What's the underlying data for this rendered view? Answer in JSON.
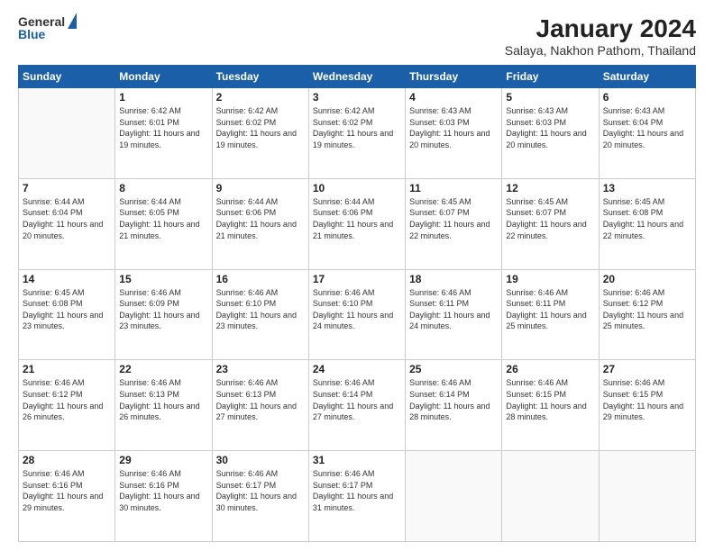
{
  "header": {
    "logo_general": "General",
    "logo_blue": "Blue",
    "title": "January 2024",
    "subtitle": "Salaya, Nakhon Pathom, Thailand"
  },
  "days_of_week": [
    "Sunday",
    "Monday",
    "Tuesday",
    "Wednesday",
    "Thursday",
    "Friday",
    "Saturday"
  ],
  "weeks": [
    [
      {
        "day": "",
        "sunrise": "",
        "sunset": "",
        "daylight": ""
      },
      {
        "day": "1",
        "sunrise": "Sunrise: 6:42 AM",
        "sunset": "Sunset: 6:01 PM",
        "daylight": "Daylight: 11 hours and 19 minutes."
      },
      {
        "day": "2",
        "sunrise": "Sunrise: 6:42 AM",
        "sunset": "Sunset: 6:02 PM",
        "daylight": "Daylight: 11 hours and 19 minutes."
      },
      {
        "day": "3",
        "sunrise": "Sunrise: 6:42 AM",
        "sunset": "Sunset: 6:02 PM",
        "daylight": "Daylight: 11 hours and 19 minutes."
      },
      {
        "day": "4",
        "sunrise": "Sunrise: 6:43 AM",
        "sunset": "Sunset: 6:03 PM",
        "daylight": "Daylight: 11 hours and 20 minutes."
      },
      {
        "day": "5",
        "sunrise": "Sunrise: 6:43 AM",
        "sunset": "Sunset: 6:03 PM",
        "daylight": "Daylight: 11 hours and 20 minutes."
      },
      {
        "day": "6",
        "sunrise": "Sunrise: 6:43 AM",
        "sunset": "Sunset: 6:04 PM",
        "daylight": "Daylight: 11 hours and 20 minutes."
      }
    ],
    [
      {
        "day": "7",
        "sunrise": "Sunrise: 6:44 AM",
        "sunset": "Sunset: 6:04 PM",
        "daylight": "Daylight: 11 hours and 20 minutes."
      },
      {
        "day": "8",
        "sunrise": "Sunrise: 6:44 AM",
        "sunset": "Sunset: 6:05 PM",
        "daylight": "Daylight: 11 hours and 21 minutes."
      },
      {
        "day": "9",
        "sunrise": "Sunrise: 6:44 AM",
        "sunset": "Sunset: 6:06 PM",
        "daylight": "Daylight: 11 hours and 21 minutes."
      },
      {
        "day": "10",
        "sunrise": "Sunrise: 6:44 AM",
        "sunset": "Sunset: 6:06 PM",
        "daylight": "Daylight: 11 hours and 21 minutes."
      },
      {
        "day": "11",
        "sunrise": "Sunrise: 6:45 AM",
        "sunset": "Sunset: 6:07 PM",
        "daylight": "Daylight: 11 hours and 22 minutes."
      },
      {
        "day": "12",
        "sunrise": "Sunrise: 6:45 AM",
        "sunset": "Sunset: 6:07 PM",
        "daylight": "Daylight: 11 hours and 22 minutes."
      },
      {
        "day": "13",
        "sunrise": "Sunrise: 6:45 AM",
        "sunset": "Sunset: 6:08 PM",
        "daylight": "Daylight: 11 hours and 22 minutes."
      }
    ],
    [
      {
        "day": "14",
        "sunrise": "Sunrise: 6:45 AM",
        "sunset": "Sunset: 6:08 PM",
        "daylight": "Daylight: 11 hours and 23 minutes."
      },
      {
        "day": "15",
        "sunrise": "Sunrise: 6:46 AM",
        "sunset": "Sunset: 6:09 PM",
        "daylight": "Daylight: 11 hours and 23 minutes."
      },
      {
        "day": "16",
        "sunrise": "Sunrise: 6:46 AM",
        "sunset": "Sunset: 6:10 PM",
        "daylight": "Daylight: 11 hours and 23 minutes."
      },
      {
        "day": "17",
        "sunrise": "Sunrise: 6:46 AM",
        "sunset": "Sunset: 6:10 PM",
        "daylight": "Daylight: 11 hours and 24 minutes."
      },
      {
        "day": "18",
        "sunrise": "Sunrise: 6:46 AM",
        "sunset": "Sunset: 6:11 PM",
        "daylight": "Daylight: 11 hours and 24 minutes."
      },
      {
        "day": "19",
        "sunrise": "Sunrise: 6:46 AM",
        "sunset": "Sunset: 6:11 PM",
        "daylight": "Daylight: 11 hours and 25 minutes."
      },
      {
        "day": "20",
        "sunrise": "Sunrise: 6:46 AM",
        "sunset": "Sunset: 6:12 PM",
        "daylight": "Daylight: 11 hours and 25 minutes."
      }
    ],
    [
      {
        "day": "21",
        "sunrise": "Sunrise: 6:46 AM",
        "sunset": "Sunset: 6:12 PM",
        "daylight": "Daylight: 11 hours and 26 minutes."
      },
      {
        "day": "22",
        "sunrise": "Sunrise: 6:46 AM",
        "sunset": "Sunset: 6:13 PM",
        "daylight": "Daylight: 11 hours and 26 minutes."
      },
      {
        "day": "23",
        "sunrise": "Sunrise: 6:46 AM",
        "sunset": "Sunset: 6:13 PM",
        "daylight": "Daylight: 11 hours and 27 minutes."
      },
      {
        "day": "24",
        "sunrise": "Sunrise: 6:46 AM",
        "sunset": "Sunset: 6:14 PM",
        "daylight": "Daylight: 11 hours and 27 minutes."
      },
      {
        "day": "25",
        "sunrise": "Sunrise: 6:46 AM",
        "sunset": "Sunset: 6:14 PM",
        "daylight": "Daylight: 11 hours and 28 minutes."
      },
      {
        "day": "26",
        "sunrise": "Sunrise: 6:46 AM",
        "sunset": "Sunset: 6:15 PM",
        "daylight": "Daylight: 11 hours and 28 minutes."
      },
      {
        "day": "27",
        "sunrise": "Sunrise: 6:46 AM",
        "sunset": "Sunset: 6:15 PM",
        "daylight": "Daylight: 11 hours and 29 minutes."
      }
    ],
    [
      {
        "day": "28",
        "sunrise": "Sunrise: 6:46 AM",
        "sunset": "Sunset: 6:16 PM",
        "daylight": "Daylight: 11 hours and 29 minutes."
      },
      {
        "day": "29",
        "sunrise": "Sunrise: 6:46 AM",
        "sunset": "Sunset: 6:16 PM",
        "daylight": "Daylight: 11 hours and 30 minutes."
      },
      {
        "day": "30",
        "sunrise": "Sunrise: 6:46 AM",
        "sunset": "Sunset: 6:17 PM",
        "daylight": "Daylight: 11 hours and 30 minutes."
      },
      {
        "day": "31",
        "sunrise": "Sunrise: 6:46 AM",
        "sunset": "Sunset: 6:17 PM",
        "daylight": "Daylight: 11 hours and 31 minutes."
      },
      {
        "day": "",
        "sunrise": "",
        "sunset": "",
        "daylight": ""
      },
      {
        "day": "",
        "sunrise": "",
        "sunset": "",
        "daylight": ""
      },
      {
        "day": "",
        "sunrise": "",
        "sunset": "",
        "daylight": ""
      }
    ]
  ]
}
